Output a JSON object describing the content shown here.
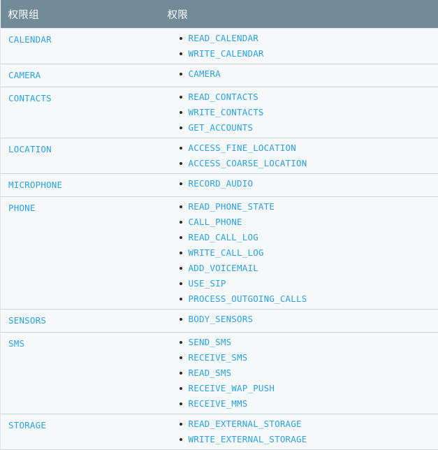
{
  "table": {
    "headers": {
      "group": "权限组",
      "permissions": "权限"
    },
    "colors": {
      "header_background": "#718b99",
      "header_text": "#ffffff",
      "row_background": "#f6f8fa",
      "row_border": "#c8d4da",
      "link_text": "#29a2e4",
      "bullet": "#2b2b2b"
    },
    "rows": [
      {
        "group": "CALENDAR",
        "permissions": [
          "READ_CALENDAR",
          "WRITE_CALENDAR"
        ]
      },
      {
        "group": "CAMERA",
        "permissions": [
          "CAMERA"
        ]
      },
      {
        "group": "CONTACTS",
        "permissions": [
          "READ_CONTACTS",
          "WRITE_CONTACTS",
          "GET_ACCOUNTS"
        ]
      },
      {
        "group": "LOCATION",
        "permissions": [
          "ACCESS_FINE_LOCATION",
          "ACCESS_COARSE_LOCATION"
        ]
      },
      {
        "group": "MICROPHONE",
        "permissions": [
          "RECORD_AUDIO"
        ]
      },
      {
        "group": "PHONE",
        "permissions": [
          "READ_PHONE_STATE",
          "CALL_PHONE",
          "READ_CALL_LOG",
          "WRITE_CALL_LOG",
          "ADD_VOICEMAIL",
          "USE_SIP",
          "PROCESS_OUTGOING_CALLS"
        ]
      },
      {
        "group": "SENSORS",
        "permissions": [
          "BODY_SENSORS"
        ]
      },
      {
        "group": "SMS",
        "permissions": [
          "SEND_SMS",
          "RECEIVE_SMS",
          "READ_SMS",
          "RECEIVE_WAP_PUSH",
          "RECEIVE_MMS"
        ]
      },
      {
        "group": "STORAGE",
        "permissions": [
          "READ_EXTERNAL_STORAGE",
          "WRITE_EXTERNAL_STORAGE"
        ]
      }
    ]
  }
}
